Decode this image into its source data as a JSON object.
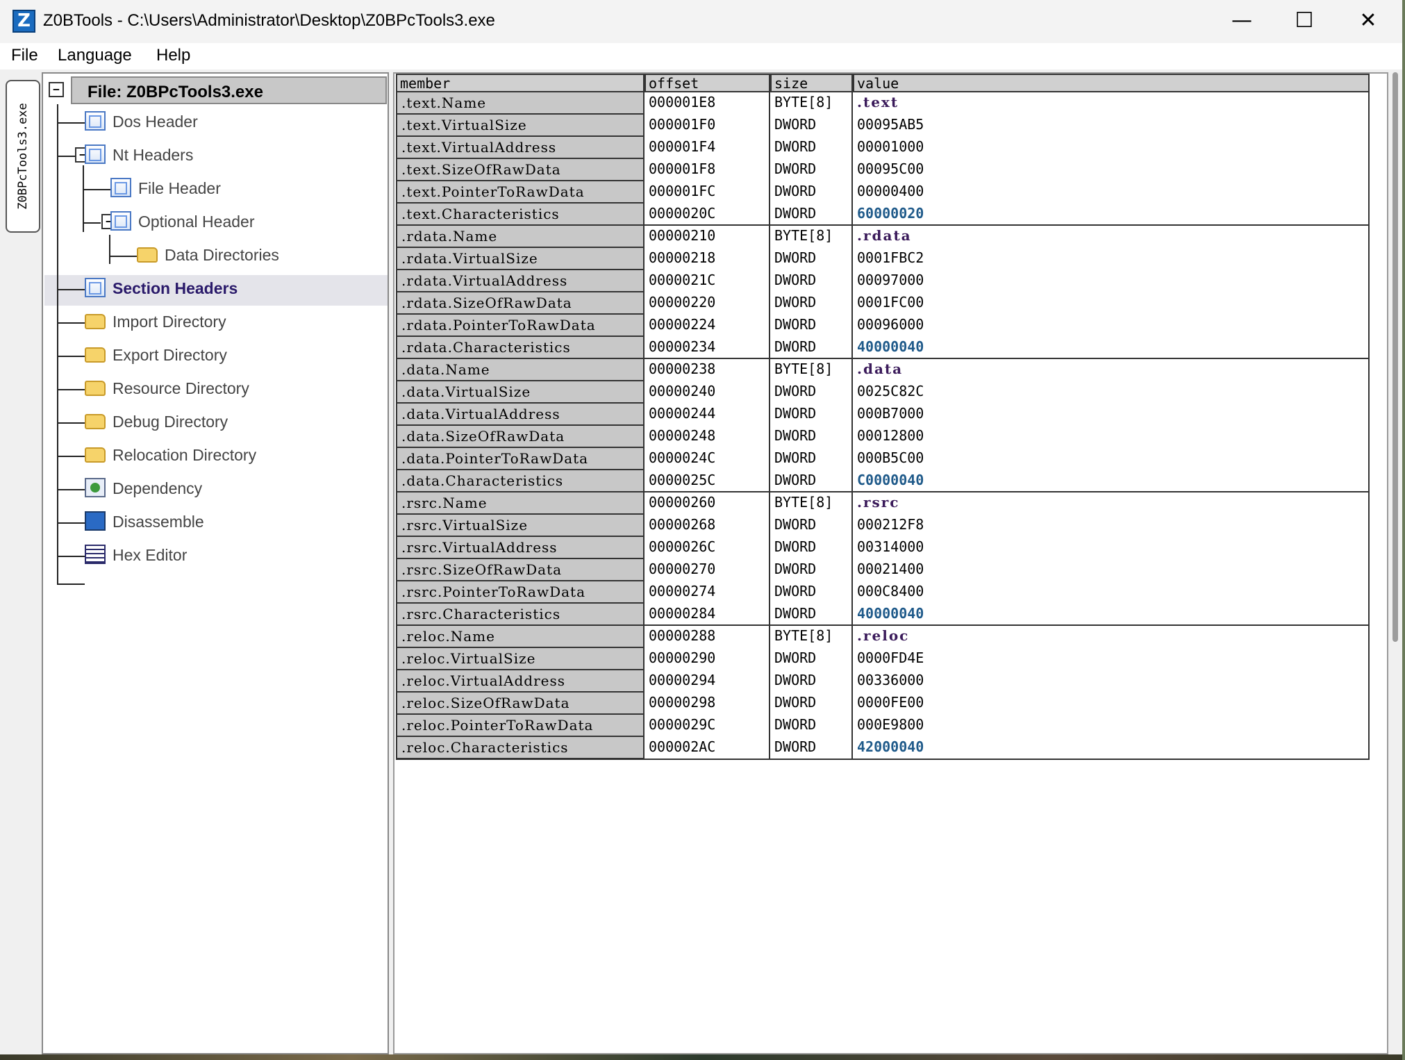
{
  "window": {
    "title": "Z0BTools - C:\\Users\\Administrator\\Desktop\\Z0BPcTools3.exe",
    "app_icon": "Z",
    "minimize": "—",
    "maximize": "☐",
    "close": "✕"
  },
  "menu": [
    "File",
    "Language",
    "Help"
  ],
  "side_tab": "Z0BPcTools3.exe",
  "tree": {
    "root": "File: Z0BPcTools3.exe",
    "nodes": {
      "dos_header": "Dos Header",
      "nt_headers": "Nt Headers",
      "file_header": "File Header",
      "optional_header": "Optional Header",
      "data_directories": "Data Directories",
      "section_headers": "Section Headers",
      "import_directory": "Import Directory",
      "export_directory": "Export Directory",
      "resource_directory": "Resource Directory",
      "debug_directory": "Debug Directory",
      "relocation_directory": "Relocation Directory",
      "dependency": "Dependency",
      "disassemble": "Disassemble",
      "hex_editor": "Hex Editor"
    }
  },
  "table": {
    "columns": [
      "member",
      "offset",
      "size",
      "value"
    ],
    "rows": [
      [
        ".text.Name",
        "000001E8",
        "BYTE[8]",
        ".text"
      ],
      [
        ".text.VirtualSize",
        "000001F0",
        "DWORD",
        "00095AB5"
      ],
      [
        ".text.VirtualAddress",
        "000001F4",
        "DWORD",
        "00001000"
      ],
      [
        ".text.SizeOfRawData",
        "000001F8",
        "DWORD",
        "00095C00"
      ],
      [
        ".text.PointerToRawData",
        "000001FC",
        "DWORD",
        "00000400"
      ],
      [
        ".text.Characteristics",
        "0000020C",
        "DWORD",
        "60000020"
      ],
      [
        ".rdata.Name",
        "00000210",
        "BYTE[8]",
        ".rdata"
      ],
      [
        ".rdata.VirtualSize",
        "00000218",
        "DWORD",
        "0001FBC2"
      ],
      [
        ".rdata.VirtualAddress",
        "0000021C",
        "DWORD",
        "00097000"
      ],
      [
        ".rdata.SizeOfRawData",
        "00000220",
        "DWORD",
        "0001FC00"
      ],
      [
        ".rdata.PointerToRawData",
        "00000224",
        "DWORD",
        "00096000"
      ],
      [
        ".rdata.Characteristics",
        "00000234",
        "DWORD",
        "40000040"
      ],
      [
        ".data.Name",
        "00000238",
        "BYTE[8]",
        ".data"
      ],
      [
        ".data.VirtualSize",
        "00000240",
        "DWORD",
        "0025C82C"
      ],
      [
        ".data.VirtualAddress",
        "00000244",
        "DWORD",
        "000B7000"
      ],
      [
        ".data.SizeOfRawData",
        "00000248",
        "DWORD",
        "00012800"
      ],
      [
        ".data.PointerToRawData",
        "0000024C",
        "DWORD",
        "000B5C00"
      ],
      [
        ".data.Characteristics",
        "0000025C",
        "DWORD",
        "C0000040"
      ],
      [
        ".rsrc.Name",
        "00000260",
        "BYTE[8]",
        ".rsrc"
      ],
      [
        ".rsrc.VirtualSize",
        "00000268",
        "DWORD",
        "000212F8"
      ],
      [
        ".rsrc.VirtualAddress",
        "0000026C",
        "DWORD",
        "00314000"
      ],
      [
        ".rsrc.SizeOfRawData",
        "00000270",
        "DWORD",
        "00021400"
      ],
      [
        ".rsrc.PointerToRawData",
        "00000274",
        "DWORD",
        "000C8400"
      ],
      [
        ".rsrc.Characteristics",
        "00000284",
        "DWORD",
        "40000040"
      ],
      [
        ".reloc.Name",
        "00000288",
        "BYTE[8]",
        ".reloc"
      ],
      [
        ".reloc.VirtualSize",
        "00000290",
        "DWORD",
        "0000FD4E"
      ],
      [
        ".reloc.VirtualAddress",
        "00000294",
        "DWORD",
        "00336000"
      ],
      [
        ".reloc.SizeOfRawData",
        "00000298",
        "DWORD",
        "0000FE00"
      ],
      [
        ".reloc.PointerToRawData",
        "0000029C",
        "DWORD",
        "000E9800"
      ],
      [
        ".reloc.Characteristics",
        "000002AC",
        "DWORD",
        "42000040"
      ]
    ]
  },
  "colors": {
    "name_value": "#3a1a5a",
    "characteristics_value": "#1f5a8a",
    "selected_tree_label": "#2a1a6a"
  },
  "icons": {
    "header_nodes": "document-icon",
    "directory_nodes": "folder-icon",
    "dependency": "dependency-icon",
    "disassemble": "disassemble-icon",
    "hex_editor": "hex-editor-icon"
  }
}
